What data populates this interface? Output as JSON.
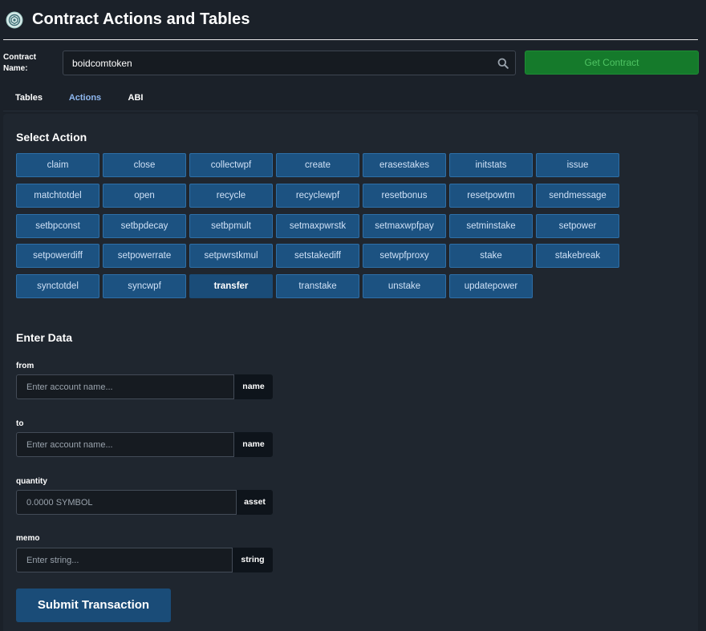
{
  "header": {
    "title": "Contract Actions and Tables"
  },
  "contract": {
    "label": "Contract Name:",
    "value": "boidcomtoken",
    "get_button": "Get Contract"
  },
  "tabs": [
    {
      "label": "Tables",
      "active": false
    },
    {
      "label": "Actions",
      "active": true
    },
    {
      "label": "ABI",
      "active": false
    }
  ],
  "actions_section": {
    "title": "Select Action",
    "selected": "transfer",
    "actions": [
      "claim",
      "close",
      "collectwpf",
      "create",
      "erasestakes",
      "initstats",
      "issue",
      "matchtotdel",
      "open",
      "recycle",
      "recyclewpf",
      "resetbonus",
      "resetpowtm",
      "sendmessage",
      "setbpconst",
      "setbpdecay",
      "setbpmult",
      "setmaxpwrstk",
      "setmaxwpfpay",
      "setminstake",
      "setpower",
      "setpowerdiff",
      "setpowerrate",
      "setpwrstkmul",
      "setstakediff",
      "setwpfproxy",
      "stake",
      "stakebreak",
      "synctotdel",
      "syncwpf",
      "transfer",
      "transtake",
      "unstake",
      "updatepower"
    ]
  },
  "data_section": {
    "title": "Enter Data",
    "fields": [
      {
        "label": "from",
        "placeholder": "Enter account name...",
        "type": "name"
      },
      {
        "label": "to",
        "placeholder": "Enter account name...",
        "type": "name"
      },
      {
        "label": "quantity",
        "placeholder": "0.0000 SYMBOL",
        "type": "asset"
      },
      {
        "label": "memo",
        "placeholder": "Enter string...",
        "type": "string"
      }
    ],
    "submit_label": "Submit Transaction"
  },
  "colors": {
    "background": "#1b2129",
    "panel": "#1f262f",
    "action_button": "#1c5281",
    "get_contract": "#157a2b",
    "tab_active": "#8fb8f0"
  }
}
